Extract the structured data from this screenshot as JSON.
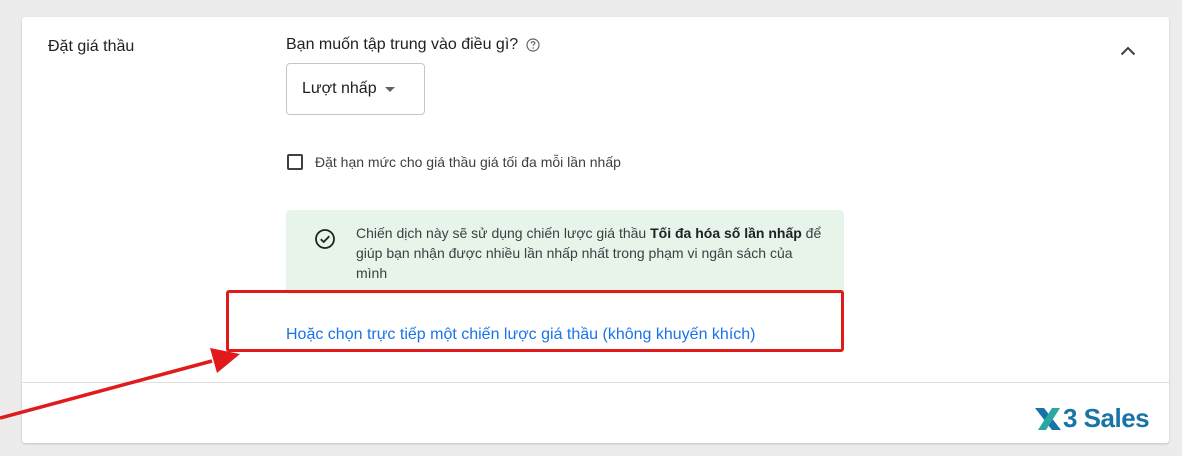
{
  "section": {
    "title": "Đặt giá thầu"
  },
  "question": {
    "label": "Bạn muốn tập trung vào điều gì?"
  },
  "dropdown": {
    "selected": "Lượt nhấp"
  },
  "checkbox": {
    "label": "Đặt hạn mức cho giá thầu giá tối đa mỗi lần nhấp",
    "checked": false
  },
  "info": {
    "text_before": "Chiến dịch này sẽ sử dụng chiến lược giá thầu ",
    "text_bold": "Tối đa hóa số lần nhấp",
    "text_after": " để giúp bạn nhận được nhiều lần nhấp nhất trong phạm vi ngân sách của mình"
  },
  "link": {
    "label": "Hoặc chọn trực tiếp một chiến lược giá thầu (không khuyến khích)"
  },
  "logo": {
    "text": "3 Sales"
  },
  "colors": {
    "link": "#1a73e8",
    "info_bg": "#e6f4ea",
    "success": "#188038",
    "annotation": "#e11b1b"
  }
}
